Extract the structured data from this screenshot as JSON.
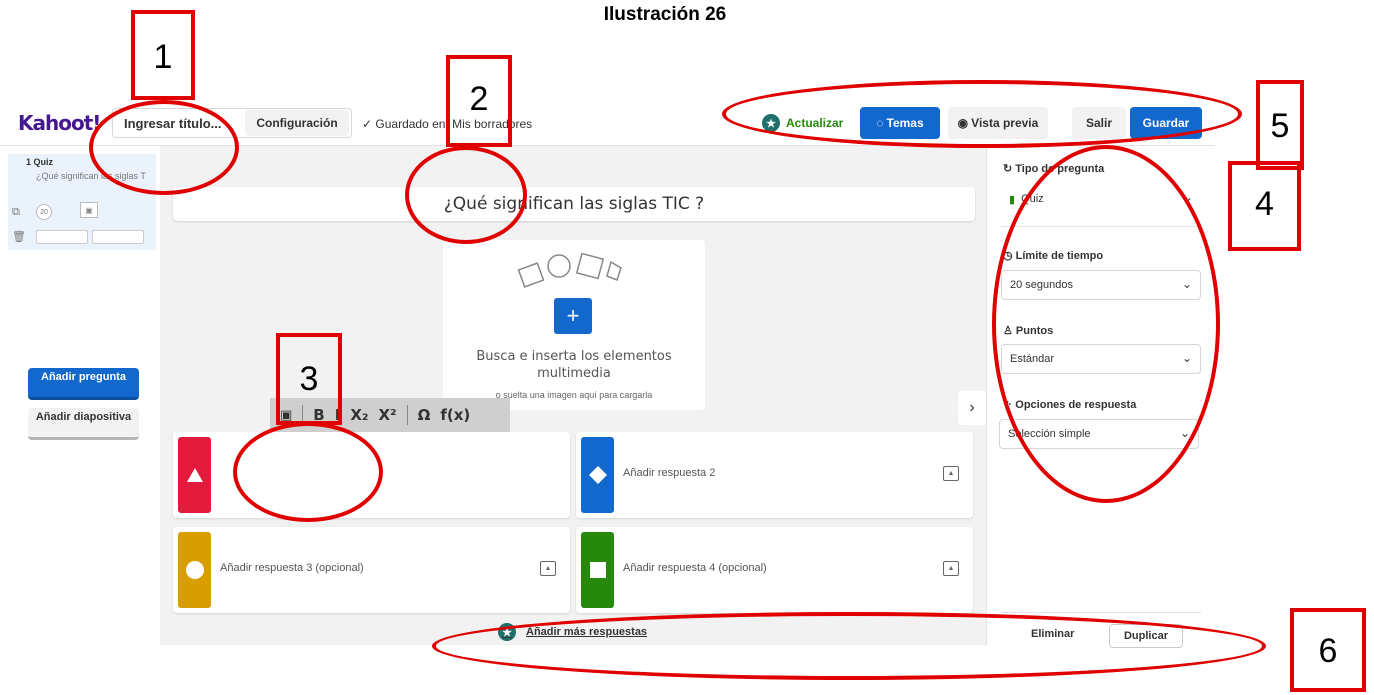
{
  "figure_title": "Ilustración  26",
  "topbar": {
    "logo": "Kahoot!",
    "title_placeholder": "Ingresar título...",
    "config_label": "Configuración",
    "saved_label": "✓ Guardado en: Mis borradores",
    "upgrade_label": "Actualizar",
    "themes_label": "Temas",
    "preview_label": "Vista previa",
    "exit_label": "Salir",
    "save_label": "Guardar"
  },
  "sidebar": {
    "slide_label": "1  Quiz",
    "slide_question": "¿Qué significan las siglas TIC ?",
    "timer": "20",
    "add_question_label": "Añadir pregunta",
    "add_slide_label": "Añadir diapositiva"
  },
  "editor": {
    "question": "¿Qué significan las siglas TIC ?",
    "media_text": "Busca e inserta los elementos multimedia",
    "media_sub": "o suelta una imagen aquí para cargarla",
    "toolbar": [
      "B",
      "I",
      "X₂",
      "X²",
      "Ω",
      "f(x)"
    ],
    "answers": [
      {
        "placeholder": "",
        "color": "#e21b3c",
        "shape": "triangle"
      },
      {
        "placeholder": "Añadir respuesta 2",
        "color": "#1368ce",
        "shape": "diamond"
      },
      {
        "placeholder": "Añadir respuesta 3 (opcional)",
        "color": "#d89e00",
        "shape": "circle"
      },
      {
        "placeholder": "Añadir respuesta 4 (opcional)",
        "color": "#26890c",
        "shape": "square"
      }
    ],
    "more_answers_label": "Añadir más respuestas"
  },
  "right_panel": {
    "question_type_label": "Tipo de pregunta",
    "question_type_value": "Quiz",
    "time_limit_label": "Límite de tiempo",
    "time_limit_value": "20 segundos",
    "points_label": "Puntos",
    "points_value": "Estándar",
    "answer_options_label": "Opciones de respuesta",
    "answer_options_value": "Selección simple",
    "delete_label": "Eliminar",
    "duplicate_label": "Duplicar"
  },
  "annotations": [
    "1",
    "2",
    "3",
    "4",
    "5",
    "6"
  ],
  "colors": {
    "annotation": "#e00000",
    "brand": "#46178f",
    "primary_blue": "#1368ce"
  }
}
